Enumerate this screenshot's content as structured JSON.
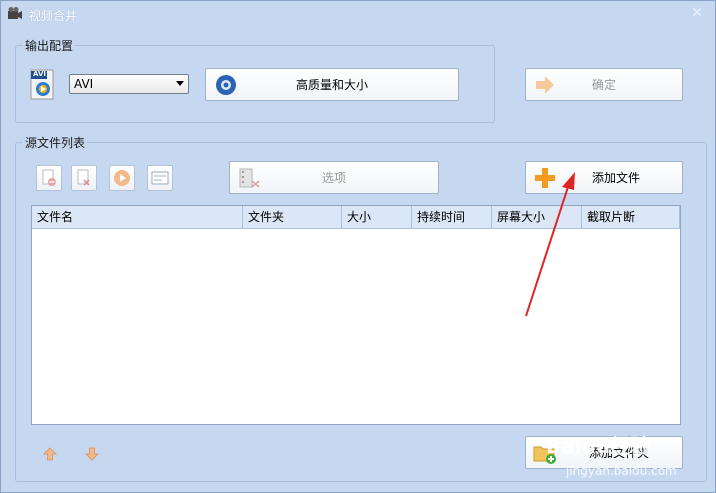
{
  "window": {
    "title": "视频合并",
    "close_glyph": "✕"
  },
  "output_config": {
    "group_label": "输出配置",
    "format_icon_text": "AVI",
    "format_select_value": "AVI",
    "quality_button_label": "高质量和大小",
    "confirm_button_label": "确定"
  },
  "source_list": {
    "group_label": "源文件列表",
    "options_button_label": "选项",
    "add_file_button_label": "添加文件",
    "add_folder_button_label": "添加文件夹",
    "columns": [
      "文件名",
      "文件夹",
      "大小",
      "持续时间",
      "屏幕大小",
      "截取片断"
    ]
  },
  "watermark": {
    "brand": "Baidu经验",
    "url": "jingyan.baidu.com"
  },
  "colors": {
    "arrow_annotation": "#e02424",
    "accent_orange": "#f39a1f"
  }
}
